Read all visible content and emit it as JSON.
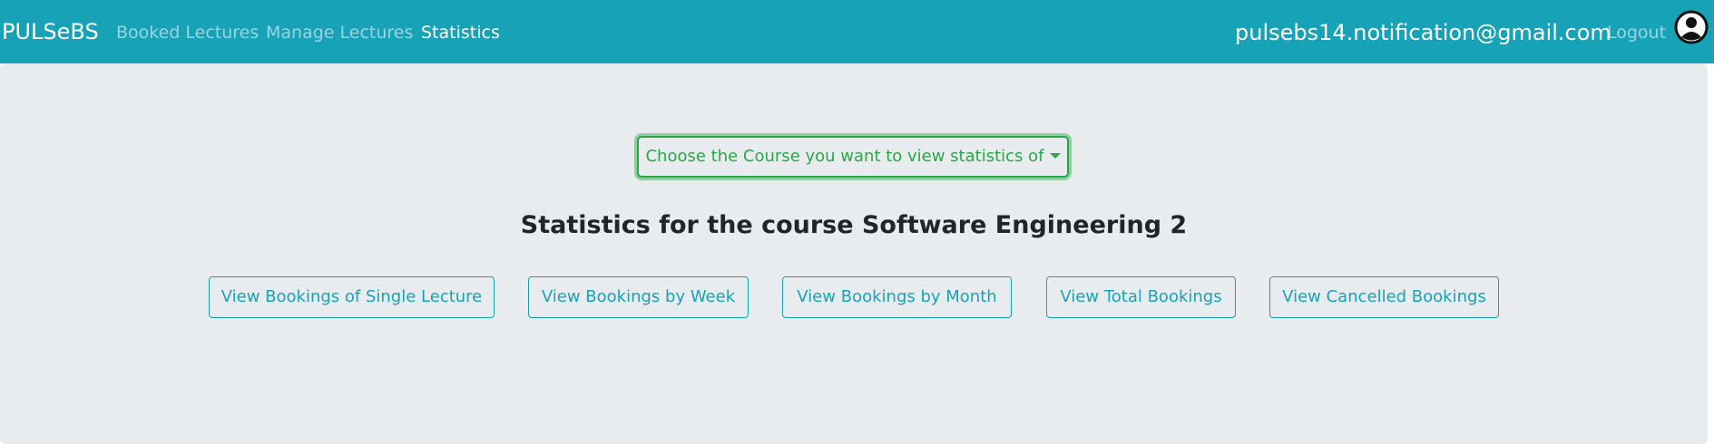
{
  "navbar": {
    "brand": "PULSeBS",
    "links": [
      {
        "label": "Booked Lectures"
      },
      {
        "label": "Manage Lectures"
      },
      {
        "label": "Statistics"
      }
    ],
    "email": "pulsebs14.notification@gmail.com",
    "logout": "Logout",
    "avatar_icon": "user-circle-icon",
    "color": "#17a2b8"
  },
  "main": {
    "course_dropdown": "Choose the Course you want to view statistics of",
    "title": "Statistics for the course Software Engineering 2",
    "buttons": [
      {
        "label": "View Bookings of Single Lecture"
      },
      {
        "label": "View Bookings by Week"
      },
      {
        "label": "View Bookings by Month"
      },
      {
        "label": "View Total Bookings"
      },
      {
        "label": "View Cancelled Bookings"
      }
    ],
    "colors": {
      "dropdown": "#28a745",
      "buttons": "#17a2b8",
      "background": "#e9ecef"
    }
  }
}
